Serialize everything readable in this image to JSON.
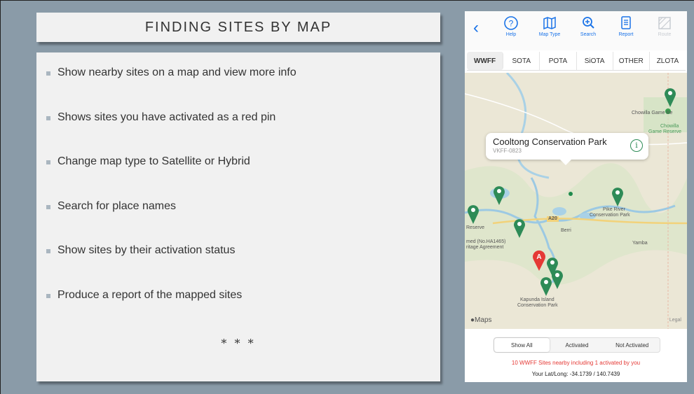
{
  "slide": {
    "title": "FINDING SITES BY MAP",
    "bullets": [
      "Show nearby sites on a map and view more info",
      "Shows sites you have activated as a red pin",
      "Change map type to Satellite or Hybrid",
      "Search for place names",
      "Show sites by their activation status",
      "Produce a report of the mapped sites"
    ],
    "footer_mark": "* * *"
  },
  "phone": {
    "toolbar": {
      "back_icon": "chevron-left-icon",
      "buttons": [
        {
          "label": "Help",
          "icon": "help-icon",
          "enabled": true
        },
        {
          "label": "Map Type",
          "icon": "map-icon",
          "enabled": true
        },
        {
          "label": "Search",
          "icon": "search-icon",
          "enabled": true
        },
        {
          "label": "Report",
          "icon": "report-icon",
          "enabled": true
        },
        {
          "label": "Route",
          "icon": "route-icon",
          "enabled": false
        }
      ]
    },
    "tabs": [
      "WWFF",
      "SOTA",
      "POTA",
      "SiOTA",
      "OTHER",
      "ZLOTA"
    ],
    "active_tab": "WWFF",
    "map": {
      "callout": {
        "name": "Cooltong Conservation Park",
        "code": "VKFF-0823"
      },
      "labels": {
        "chowilla_game": "Chowilla Game Re",
        "chowilla_reserve_1": "Chowilla",
        "chowilla_reserve_2": "Game Reserve",
        "pike_river_1": "Pike River",
        "pike_river_2": "Conservation Park",
        "reserve": "Reserve",
        "ha1465_1": "med (No.HA1465)",
        "ha1465_2": "ritage Agreement",
        "berri": "Berri",
        "yamba": "Yamba",
        "road": "A20",
        "kapunda_1": "Kapunda Island",
        "kapunda_2": "Conservation Park",
        "activated_pin": "A"
      },
      "attribution": "Maps",
      "legal": "Legal"
    },
    "filters": [
      "Show All",
      "Activated",
      "Not Activated"
    ],
    "active_filter": "Show All",
    "summary": "10 WWFF Sites nearby including 1 activated by you",
    "latlong": "Your Lat/Long: -34.1739 / 140.7439",
    "colors": {
      "accent": "#1a73e8",
      "pin_green": "#2e8b57",
      "pin_red": "#e53935"
    }
  }
}
